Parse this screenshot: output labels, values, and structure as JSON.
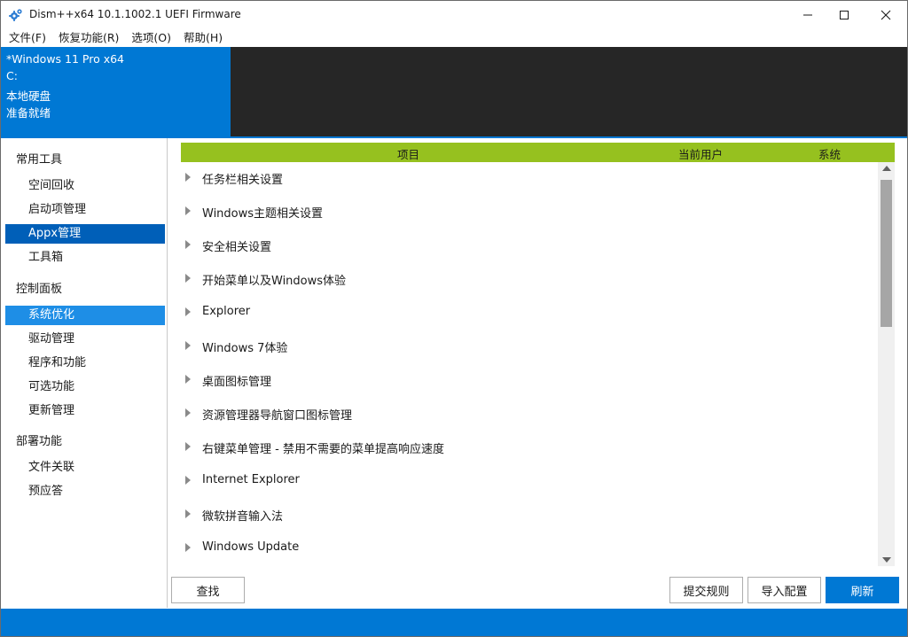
{
  "window": {
    "title": "Dism++x64 10.1.1002.1 UEFI Firmware",
    "icon": "gears-icon",
    "controls": [
      "minimize-icon",
      "maximize-icon",
      "close-icon"
    ]
  },
  "menu": [
    {
      "label": "文件(F)"
    },
    {
      "label": "恢复功能(R)"
    },
    {
      "label": "选项(O)"
    },
    {
      "label": "帮助(H)"
    }
  ],
  "session": {
    "os": "*Windows 11 Pro x64",
    "drive": "C:",
    "disk_type": "本地硬盘",
    "status": "准备就绪"
  },
  "sidebar": {
    "categories": [
      {
        "label": "常用工具",
        "items": [
          {
            "label": "空间回收"
          },
          {
            "label": "启动项管理"
          },
          {
            "label": "Appx管理"
          },
          {
            "label": "工具箱"
          }
        ]
      },
      {
        "label": "控制面板",
        "items": [
          {
            "label": "系统优化"
          },
          {
            "label": "驱动管理"
          },
          {
            "label": "程序和功能"
          },
          {
            "label": "可选功能"
          },
          {
            "label": "更新管理"
          }
        ]
      },
      {
        "label": "部署功能",
        "items": [
          {
            "label": "文件关联"
          },
          {
            "label": "预应答"
          }
        ]
      }
    ]
  },
  "table": {
    "columns": [
      "项目",
      "当前用户",
      "系统"
    ],
    "rows": [
      {
        "label": "任务栏相关设置"
      },
      {
        "label": "Windows主题相关设置"
      },
      {
        "label": "安全相关设置"
      },
      {
        "label": "开始菜单以及Windows体验"
      },
      {
        "label": "Explorer"
      },
      {
        "label": "Windows 7体验"
      },
      {
        "label": "桌面图标管理"
      },
      {
        "label": "资源管理器导航窗口图标管理"
      },
      {
        "label": "右键菜单管理 - 禁用不需要的菜单提高响应速度"
      },
      {
        "label": "Internet Explorer"
      },
      {
        "label": "微软拼音输入法"
      },
      {
        "label": "Windows Update"
      }
    ]
  },
  "buttons": {
    "find": "查找",
    "submit_rules": "提交规则",
    "import_config": "导入配置",
    "refresh": "刷新"
  },
  "colors": {
    "accent": "#0078d4",
    "header_green": "#96c11f",
    "selection_dark": "#005fb8",
    "selection_light": "#1e8ee6",
    "info_dark": "#262626"
  }
}
